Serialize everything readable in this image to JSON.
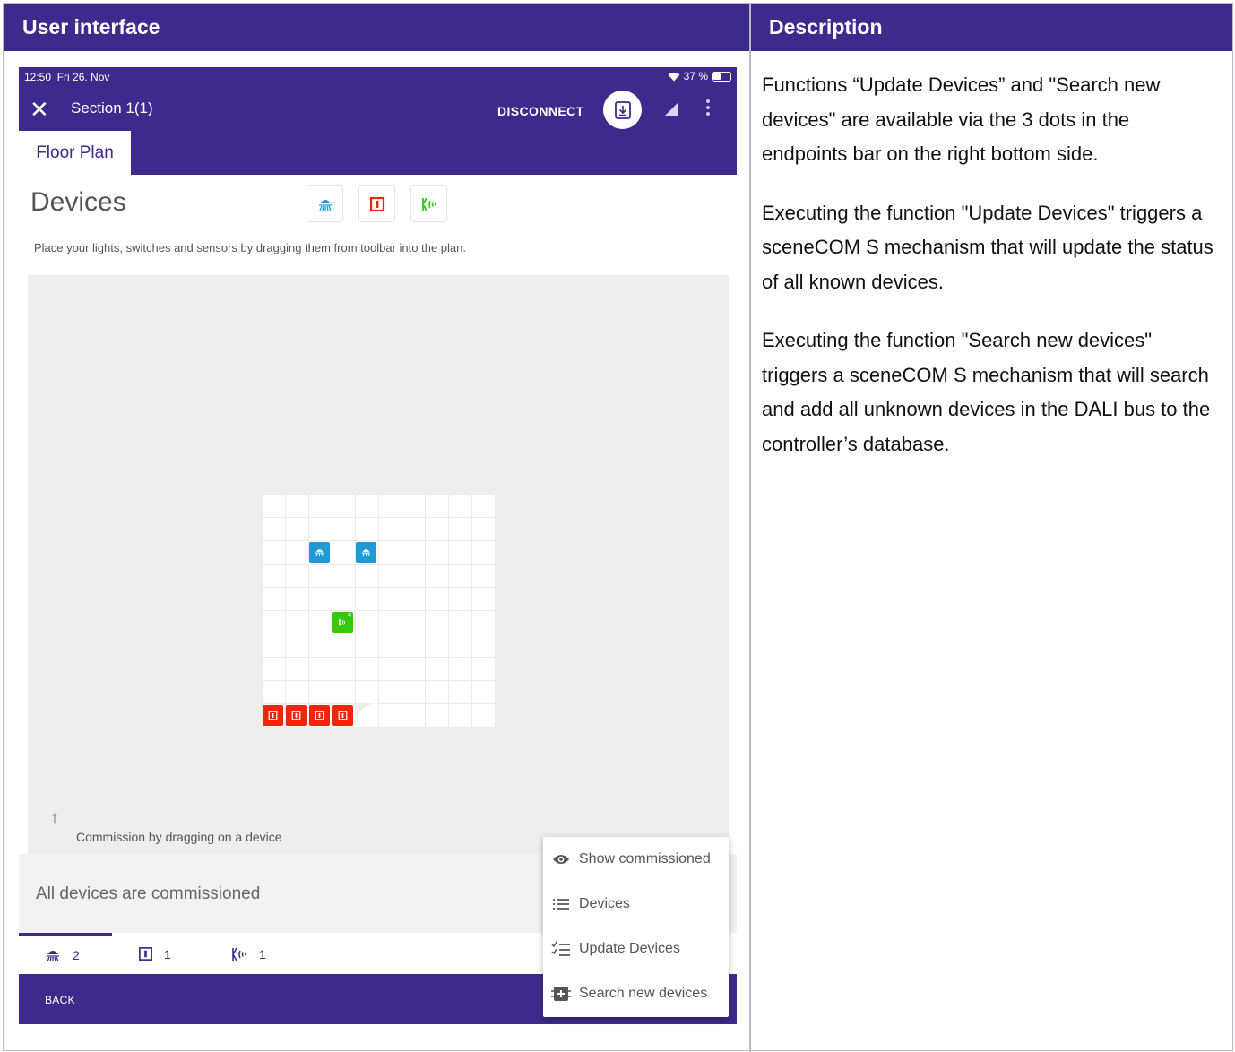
{
  "columns": {
    "left_header": "User interface",
    "right_header": "Description"
  },
  "description": {
    "paragraphs": [
      "Functions “Update Devices” and \"Search new devices\" are available via the 3 dots in the endpoints bar on the right bottom side.",
      "Executing the function \"Update Devices\" triggers a sceneCOM S mechanism that will update the status of all known devices.",
      "Executing the function \"Search new devices\" triggers a sceneCOM S mechanism that will search and add all unknown devices in the DALI bus to the controller’s database."
    ]
  },
  "app": {
    "status_time": "12:50",
    "status_date": "Fri 26. Nov",
    "battery": "37 %",
    "title": "Section 1(1)",
    "disconnect_label": "DISCONNECT",
    "tab_label": "Floor Plan",
    "devices_title": "Devices",
    "hint": "Place your lights, switches and sensors by dragging them from toolbar into the plan.",
    "commission_hint": "Commission by dragging on a device",
    "arrow_glyph": "↑",
    "close_glyph": "✕",
    "all_commissioned": "All devices are commissioned",
    "back_label": "BACK",
    "sensor_badge": "4",
    "endpoints": [
      {
        "icon": "light-icon",
        "count": "2"
      },
      {
        "icon": "switch-icon",
        "count": "1"
      },
      {
        "icon": "sensor-icon",
        "count": "1"
      }
    ],
    "menu": [
      {
        "icon": "eye-icon",
        "label": "Show commissioned"
      },
      {
        "icon": "list-icon",
        "label": "Devices"
      },
      {
        "icon": "checklist-icon",
        "label": "Update Devices"
      },
      {
        "icon": "add-device-icon",
        "label": "Search new devices"
      }
    ],
    "colors": {
      "primary": "#3d2a8c",
      "light": "#1e9ad6",
      "switch": "#f0260a",
      "sensor": "#35c80f"
    }
  }
}
